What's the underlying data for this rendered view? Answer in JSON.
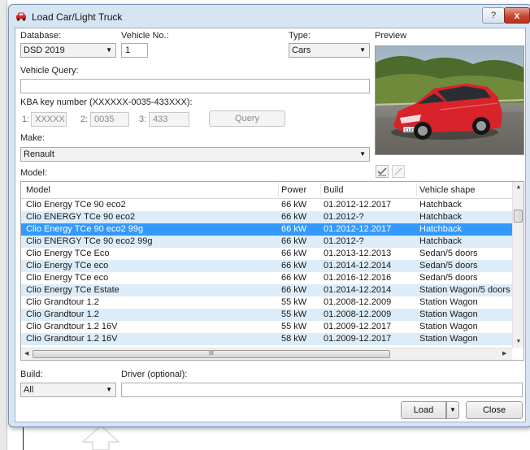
{
  "window": {
    "title": "Load Car/Light Truck",
    "help_label": "?",
    "close_label": "x"
  },
  "colors": {
    "selection": "#3399ff",
    "alt_row": "#dcecf8",
    "frame": "#d7e4f2",
    "car_red": "#d8232a"
  },
  "form": {
    "database_label": "Database:",
    "database_value": "DSD 2019",
    "vehicle_no_label": "Vehicle No.:",
    "vehicle_no_value": "1",
    "type_label": "Type:",
    "type_value": "Cars",
    "preview_label": "Preview",
    "vehicle_query_label": "Vehicle Query:",
    "vehicle_query_value": "",
    "kba_label": "KBA key number (XXXXXX-0035-433XXX):",
    "kba1_label": "1:",
    "kba1_value": "XXXXX",
    "kba2_label": "2:",
    "kba2_value": "0035",
    "kba3_label": "3:",
    "kba3_value": "433",
    "query_button": "Query",
    "make_label": "Make:",
    "make_value": "Renault",
    "model_label": "Model:"
  },
  "table": {
    "columns": [
      "Model",
      "Power",
      "Build",
      "Vehicle shape"
    ],
    "rows": [
      {
        "model": "Clio Energy TCe 90 eco2",
        "power": "66 kW",
        "build": "01.2012-12.2017",
        "shape": "Hatchback"
      },
      {
        "model": "Clio ENERGY TCe 90 eco2",
        "power": "66 kW",
        "build": "01.2012-?",
        "shape": "Hatchback"
      },
      {
        "model": "Clio Energy TCe 90 eco2 99g",
        "power": "66 kW",
        "build": "01.2012-12.2017",
        "shape": "Hatchback",
        "selected": true
      },
      {
        "model": "Clio ENERGY TCe 90 eco2 99g",
        "power": "66 kW",
        "build": "01.2012-?",
        "shape": "Hatchback"
      },
      {
        "model": "Clio Energy TCe Eco",
        "power": "66 kW",
        "build": "01.2013-12.2013",
        "shape": "Sedan/5 doors"
      },
      {
        "model": "Clio Energy TCe eco",
        "power": "66 kW",
        "build": "01.2014-12.2014",
        "shape": "Sedan/5 doors"
      },
      {
        "model": "Clio Energy TCe eco",
        "power": "66 kW",
        "build": "01.2016-12.2016",
        "shape": "Sedan/5 doors"
      },
      {
        "model": "Clio Energy TCe Estate",
        "power": "66 kW",
        "build": "01.2014-12.2014",
        "shape": "Station Wagon/5 doors"
      },
      {
        "model": "Clio Grandtour 1.2",
        "power": "55 kW",
        "build": "01.2008-12.2009",
        "shape": "Station Wagon"
      },
      {
        "model": "Clio Grandtour 1.2",
        "power": "55 kW",
        "build": "01.2008-12.2009",
        "shape": "Station Wagon"
      },
      {
        "model": "Clio Grandtour 1.2 16V",
        "power": "55 kW",
        "build": "01.2009-12.2017",
        "shape": "Station Wagon"
      },
      {
        "model": "Clio Grandtour 1.2 16V",
        "power": "58 kW",
        "build": "01.2009-12.2017",
        "shape": "Station Wagon"
      }
    ],
    "hscroll_grip": "III"
  },
  "footer": {
    "build_label": "Build:",
    "build_value": "All",
    "driver_label": "Driver (optional):",
    "driver_value": "",
    "load_button": "Load",
    "close_button": "Close"
  },
  "preview_image": {
    "plate_text": "CLIO 4"
  }
}
